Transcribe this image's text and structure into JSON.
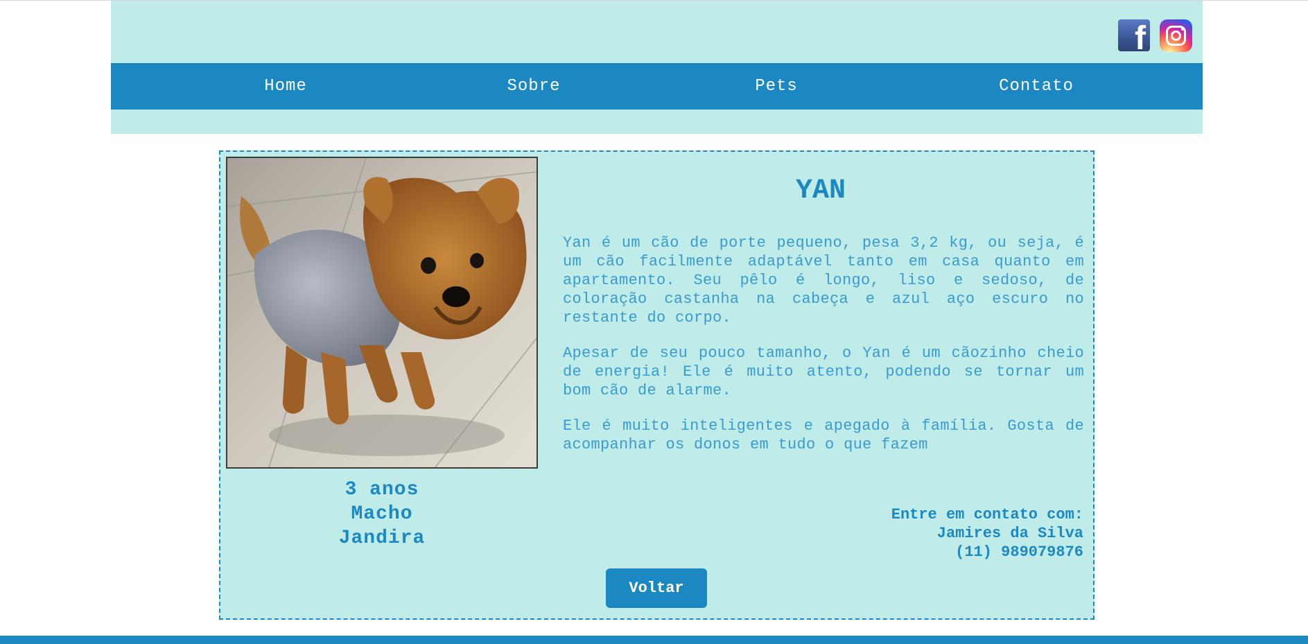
{
  "social": {
    "facebook_icon": "facebook-icon",
    "instagram_icon": "instagram-icon",
    "facebook_glyph": "f"
  },
  "nav": {
    "items": [
      {
        "label": "Home"
      },
      {
        "label": "Sobre"
      },
      {
        "label": "Pets"
      },
      {
        "label": "Contato"
      }
    ]
  },
  "pet": {
    "name": "YAN",
    "photo_icon": "dog-photo",
    "age": "3 anos",
    "sex": "Macho",
    "city": "Jandira",
    "description": [
      "Yan é um cão de porte pequeno, pesa 3,2 kg, ou seja, é um cão facilmente adaptável tanto em casa quanto em apartamento. Seu pêlo é longo, liso e sedoso, de coloração castanha na cabeça e azul aço escuro no restante do corpo.",
      "Apesar de seu pouco tamanho, o Yan é um cãozinho cheio de energia! Ele é muito atento, podendo se tornar um bom cão de alarme.",
      "Ele é muito inteligentes e apegado à família. Gosta de acompanhar os donos em tudo o que fazem"
    ]
  },
  "contact": {
    "label": "Entre em contato com:",
    "person": "Jamires da Silva",
    "phone": "(11) 989079876"
  },
  "back_button": {
    "label": "Voltar"
  },
  "colors": {
    "primary": "#1c88c2",
    "background_light": "#bfebe8",
    "text_light": "#3a9bd0"
  }
}
